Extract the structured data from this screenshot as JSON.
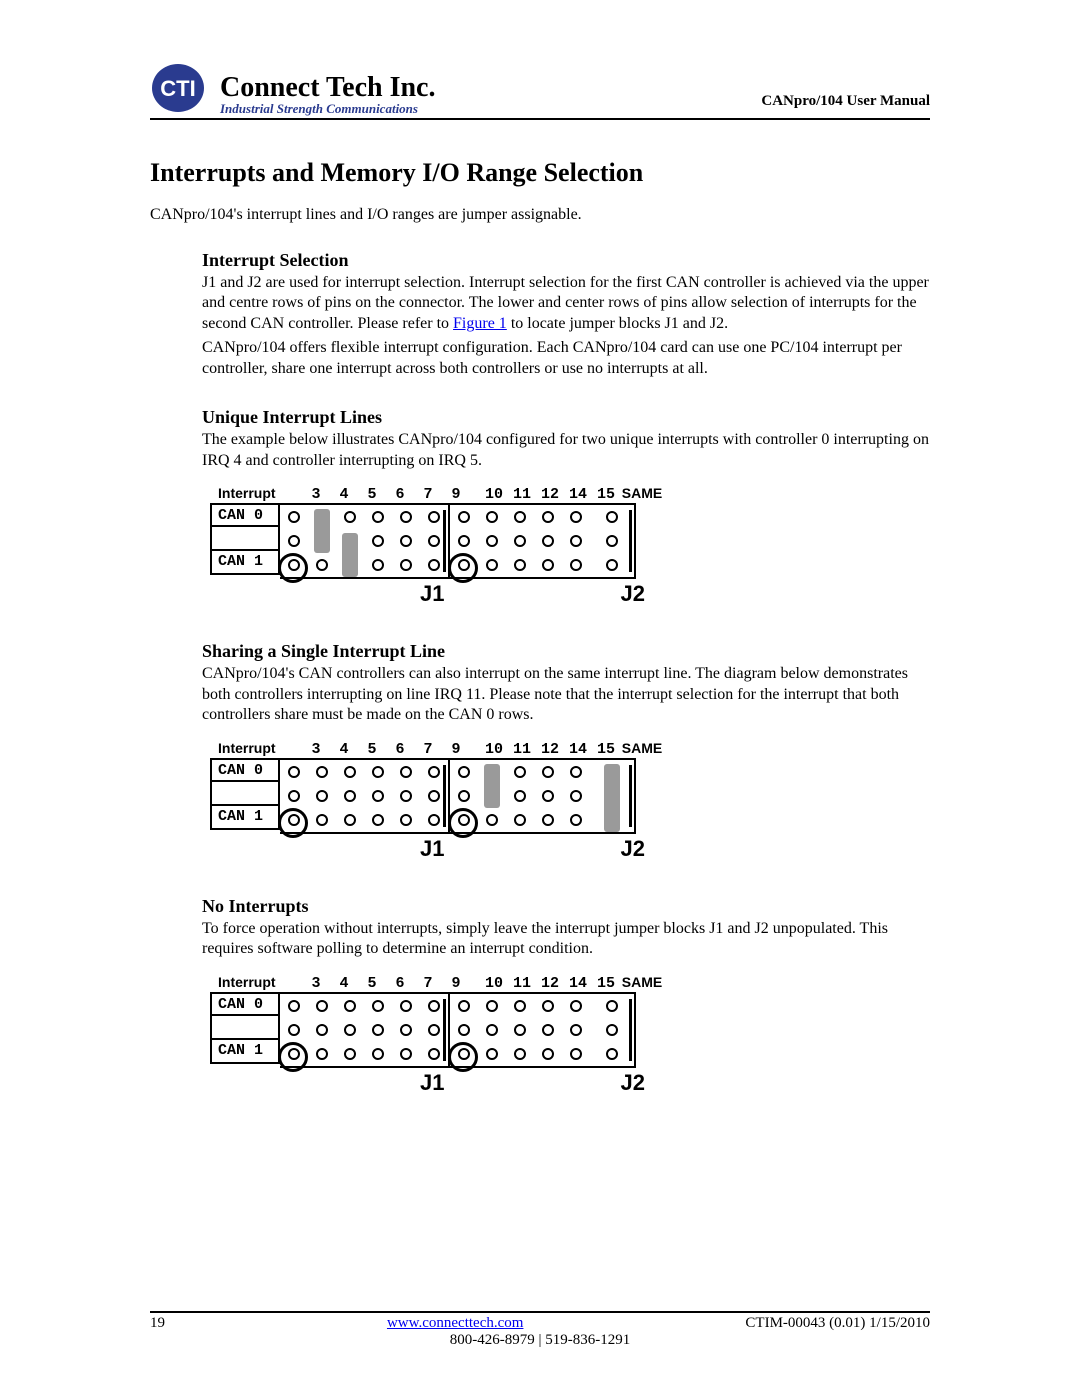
{
  "header": {
    "company": "Connect Tech Inc.",
    "tagline": "Industrial Strength Communications",
    "doc_title": "CANpro/104 User Manual",
    "logo_initials": "CTI"
  },
  "h1": "Interrupts and Memory I/O Range Selection",
  "intro": "CANpro/104's interrupt lines and I/O ranges are jumper assignable.",
  "s_interrupt": {
    "heading": "Interrupt Selection",
    "p1a": "J1 and J2 are used for interrupt selection.  Interrupt selection for the first CAN controller is achieved via the upper and centre rows of pins on the connector. The lower and center rows of pins allow selection of interrupts for the second CAN controller.  Please refer to ",
    "figlink": "Figure 1",
    "p1b": " to locate jumper blocks J1 and J2.",
    "p2": "CANpro/104 offers flexible interrupt configuration.  Each CANpro/104 card can use one PC/104 interrupt per controller, share one interrupt across both controllers or use no interrupts at all."
  },
  "s_unique": {
    "heading": "Unique Interrupt Lines",
    "p": "The example below illustrates CANpro/104 configured for two unique interrupts with controller 0 interrupting on IRQ 4 and controller interrupting on IRQ 5."
  },
  "s_sharing": {
    "heading": "Sharing a Single Interrupt Line",
    "p": "CANpro/104's CAN controllers can also interrupt on the same interrupt line.  The diagram below demonstrates both controllers interrupting on line IRQ 11. Please note that the interrupt selection for the interrupt that both controllers share must be made on the CAN 0 rows."
  },
  "s_noint": {
    "heading": "No Interrupts",
    "p": "To force operation without interrupts, simply leave the interrupt jumper blocks J1 and J2 unpopulated.  This requires software polling to determine an interrupt condition."
  },
  "diagram": {
    "header_label": "Interrupt",
    "j1_cols": [
      "3",
      "4",
      "5",
      "6",
      "7",
      "9"
    ],
    "j2_cols": [
      "10",
      "11",
      "12",
      "14",
      "15"
    ],
    "same_label": "SAME",
    "row_can0": "CAN 0",
    "row_mid": "",
    "row_can1": "CAN 1",
    "tag_j1": "J1",
    "tag_j2": "J2"
  },
  "diagrams_cfg": {
    "unique": {
      "jumpers": [
        {
          "half": "left",
          "col": 1,
          "rows": "top",
          "comment": "CAN0 IRQ4 upper+centre"
        },
        {
          "half": "left",
          "col": 2,
          "rows": "bot",
          "comment": "CAN1 IRQ5 lower+centre"
        }
      ]
    },
    "sharing": {
      "jumpers": [
        {
          "half": "right",
          "col": 1,
          "rows": "top",
          "comment": "CAN0 IRQ11"
        },
        {
          "half": "right",
          "col": 5,
          "rows": "full",
          "comment": "SAME"
        }
      ]
    },
    "noint": {
      "jumpers": []
    }
  },
  "footer": {
    "page": "19",
    "url": "www.connecttech.com",
    "docnum": "CTIM-00043 (0.01) 1/15/2010",
    "phones": "800-426-8979 | 519-836-1291"
  }
}
